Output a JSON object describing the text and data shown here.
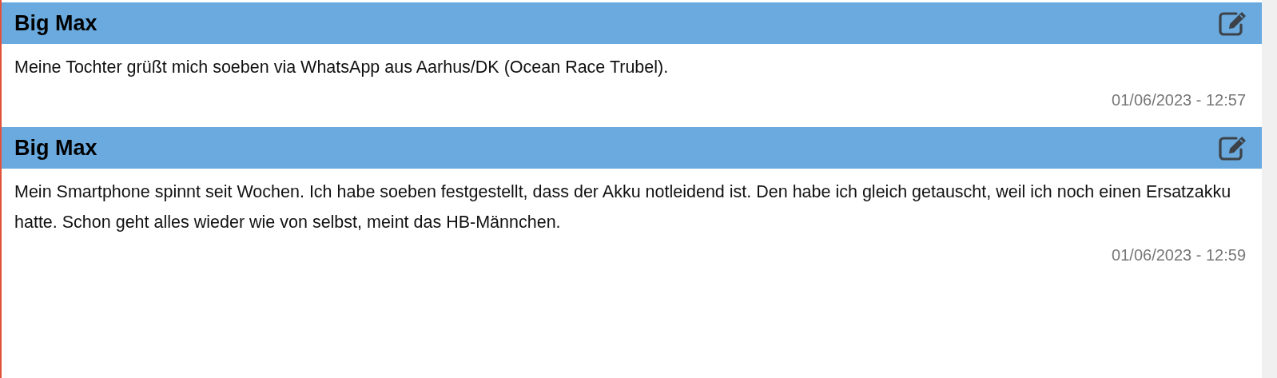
{
  "posts": [
    {
      "author": "Big Max",
      "text": "Meine Tochter grüßt mich soeben via WhatsApp aus Aarhus/DK (Ocean Race Trubel).",
      "timestamp": "01/06/2023 - 12:57"
    },
    {
      "author": "Big Max",
      "text": "Mein Smartphone spinnt seit Wochen. Ich habe soeben festgestellt, dass der Akku notleidend ist. Den habe ich gleich getauscht, weil ich noch einen Ersatzakku hatte. Schon geht alles wieder wie von selbst, meint das HB-Männchen.",
      "timestamp": "01/06/2023 - 12:59"
    }
  ]
}
